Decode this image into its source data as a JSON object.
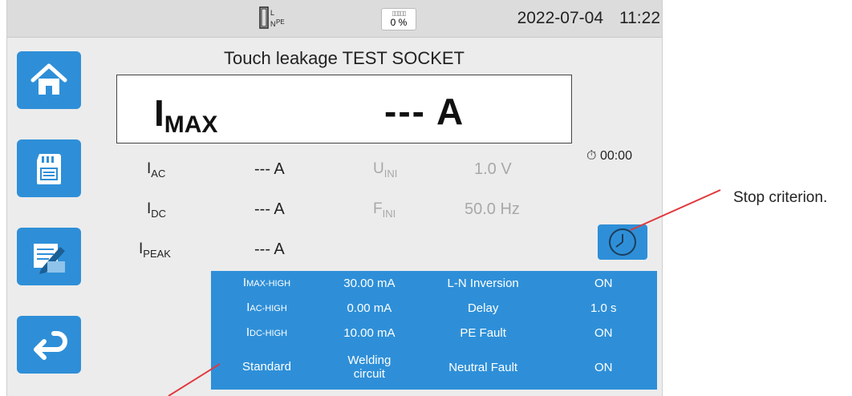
{
  "status_bar": {
    "plug_labels": {
      "l": "L",
      "n": "N",
      "pe": "PE"
    },
    "battery_percent": "0 %",
    "date": "2022-07-04",
    "time": "11:22"
  },
  "sidebar": {
    "buttons": [
      {
        "name": "home",
        "icon": "home-icon"
      },
      {
        "name": "memory",
        "icon": "sd-card-icon"
      },
      {
        "name": "report",
        "icon": "report-edit-icon"
      },
      {
        "name": "return",
        "icon": "return-arrow-icon"
      }
    ]
  },
  "title": "Touch leakage TEST SOCKET",
  "main_reading": {
    "label_main": "I",
    "label_sub": "MAX",
    "value": "--- A"
  },
  "measurements": [
    {
      "label_main": "I",
      "label_sub": "AC",
      "value": "--- A"
    },
    {
      "label_main": "I",
      "label_sub": "DC",
      "value": "--- A"
    },
    {
      "label_main": "I",
      "label_sub": "PEAK",
      "value": "--- A"
    }
  ],
  "secondary": [
    {
      "label_main": "U",
      "label_sub": "INI",
      "value": "1.0 V"
    },
    {
      "label_main": "F",
      "label_sub": "INI",
      "value": "50.0 Hz"
    }
  ],
  "timer": {
    "icon": "stopwatch-icon",
    "value": "00:00"
  },
  "stop_button": {
    "icon": "clock-icon"
  },
  "params": {
    "rows": [
      {
        "k1_main": "I",
        "k1_sub": "MAX-HIGH",
        "v1": "30.00 mA",
        "k2": "L-N Inversion",
        "v2": "ON"
      },
      {
        "k1_main": "I",
        "k1_sub": "AC-HIGH",
        "v1": "0.00 mA",
        "k2": "Delay",
        "v2": "1.0 s"
      },
      {
        "k1_main": "I",
        "k1_sub": "DC-HIGH",
        "v1": "10.00 mA",
        "k2": "PE Fault",
        "v2": "ON"
      },
      {
        "k1_main": "Standard",
        "k1_sub": "",
        "v1": "Welding circuit",
        "k2": "Neutral Fault",
        "v2": "ON"
      }
    ]
  },
  "callout": {
    "text": "Stop criterion."
  },
  "colors": {
    "accent": "#2e8fd8",
    "callout_line": "#e0393e"
  }
}
